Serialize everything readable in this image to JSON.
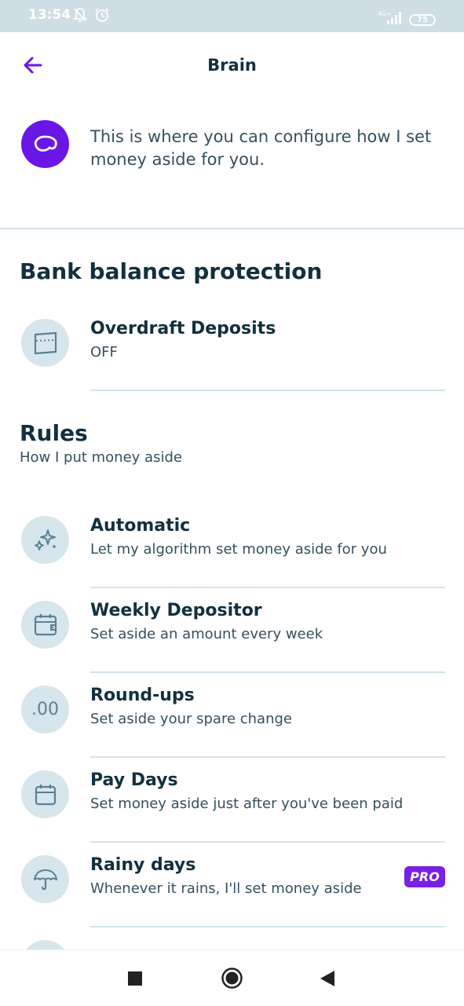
{
  "status_bar": {
    "time": "13:54",
    "network": "4G+",
    "battery": "75"
  },
  "header": {
    "title": "Brain"
  },
  "intro": {
    "text": "This is where you can configure how I set money aside for you."
  },
  "bank_section": {
    "title": "Bank balance protection"
  },
  "overdraft": {
    "title": "Overdraft Deposits",
    "status": "OFF"
  },
  "rules_section": {
    "title": "Rules",
    "subtitle": "How I put money aside"
  },
  "rules": [
    {
      "title": "Automatic",
      "subtitle": "Let my algorithm set money aside for you",
      "icon": "sparkle-icon"
    },
    {
      "title": "Weekly Depositor",
      "subtitle": "Set aside an amount every week",
      "icon": "calendar-wallet-icon"
    },
    {
      "title": "Round-ups",
      "subtitle": "Set aside your spare change",
      "icon_text": ".00",
      "icon": "round-up-icon"
    },
    {
      "title": "Pay Days",
      "subtitle": "Set money aside just after you've been paid",
      "icon": "calendar-icon"
    },
    {
      "title": "Rainy days",
      "subtitle": "Whenever it rains, I'll set money aside",
      "icon": "umbrella-icon",
      "badge": "PRO"
    }
  ],
  "colors": {
    "accent": "#6a16e6",
    "pro": "#7a1fe6",
    "icon_bg": "#d7e5ec",
    "text_dark": "#12303f"
  }
}
